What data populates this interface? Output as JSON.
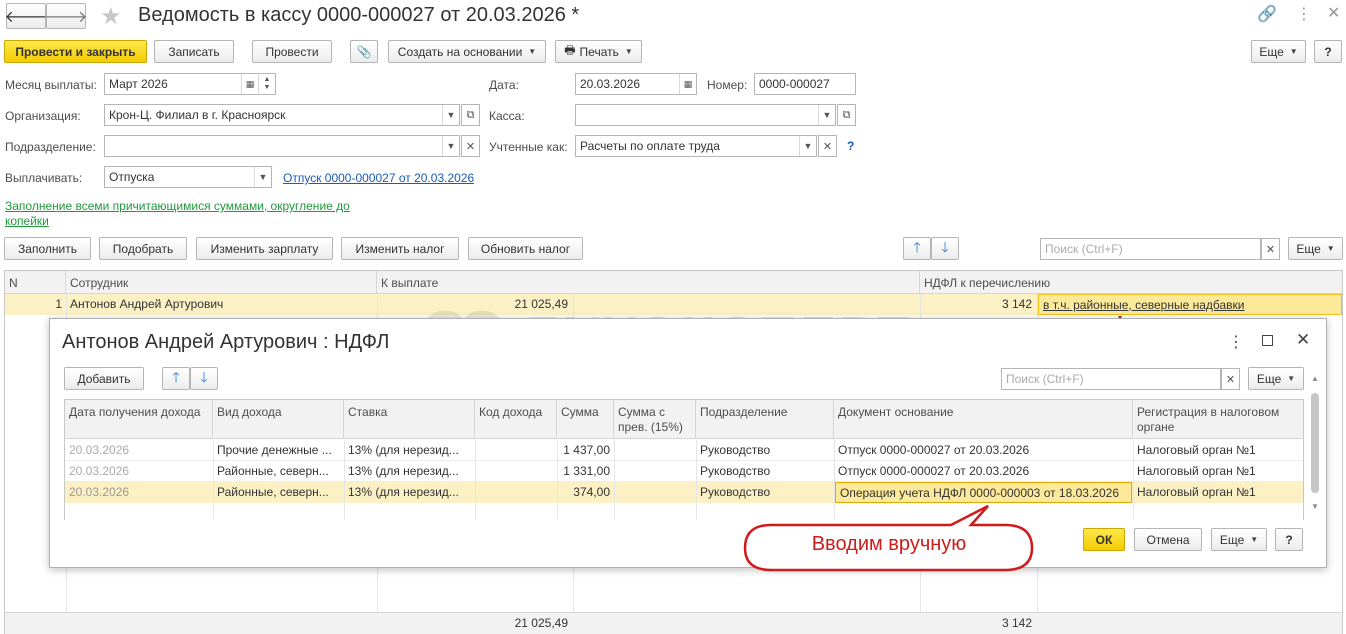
{
  "window": {
    "title": "Ведомость в кассу 0000-000027 от 20.03.2026 *"
  },
  "toolbar": {
    "post_close": "Провести и закрыть",
    "save": "Записать",
    "post": "Провести",
    "create_based": "Создать на основании",
    "print": "Печать",
    "more": "Еще",
    "help": "?"
  },
  "form": {
    "month_label": "Месяц выплаты:",
    "month_value": "Март 2026",
    "date_label": "Дата:",
    "date_value": "20.03.2026",
    "number_label": "Номер:",
    "number_value": "0000-000027",
    "org_label": "Организация:",
    "org_value": "Крон-Ц. Филиал в г. Красноярск",
    "cash_label": "Касса:",
    "cash_value": "",
    "dept_label": "Подразделение:",
    "dept_value": "",
    "accounted_label": "Учтенные как:",
    "accounted_value": "Расчеты по оплате труда",
    "pay_label": "Выплачивать:",
    "pay_value": "Отпуска",
    "pay_link": "Отпуск 0000-000027 от 20.03.2026",
    "fill_link": "Заполнение всеми причитающимися суммами, округление до копейки",
    "help_q": "?"
  },
  "table_toolbar": {
    "fill": "Заполнить",
    "pick": "Подобрать",
    "change_salary": "Изменить зарплату",
    "change_tax": "Изменить налог",
    "update_tax": "Обновить налог",
    "search_placeholder": "Поиск (Ctrl+F)",
    "more": "Еще"
  },
  "main_table": {
    "columns": [
      "N",
      "Сотрудник",
      "К выплате",
      "НДФЛ к перечислению"
    ],
    "rows": [
      {
        "n": "1",
        "employee": "Антонов Андрей Артурович",
        "pay": "21 025,49",
        "ndfl": "3 142",
        "note": "в т.ч. районные, северные надбавки"
      }
    ],
    "footer": {
      "pay": "21 025,49",
      "ndfl": "3 142"
    }
  },
  "watermark": "БУХЭКСПЕРТ",
  "dialog": {
    "title": "Антонов Андрей Артурович : НДФЛ",
    "add": "Добавить",
    "search_placeholder": "Поиск (Ctrl+F)",
    "more": "Еще",
    "columns": [
      "Дата получения дохода",
      "Вид дохода",
      "Ставка",
      "Код дохода",
      "Сумма",
      "Сумма с прев. (15%)",
      "Подразделение",
      "Документ основание",
      "Регистрация в налоговом органе"
    ],
    "rows": [
      {
        "date": "20.03.2026",
        "kind": "Прочие денежные ...",
        "rate": "13% (для нерезид...",
        "code": "",
        "sum": "1 437,00",
        "sum15": "",
        "dept": "Руководство",
        "doc": "Отпуск 0000-000027 от 20.03.2026",
        "reg": "Налоговый орган №1"
      },
      {
        "date": "20.03.2026",
        "kind": "Районные, северн...",
        "rate": "13% (для нерезид...",
        "code": "",
        "sum": "1 331,00",
        "sum15": "",
        "dept": "Руководство",
        "doc": "Отпуск 0000-000027 от 20.03.2026",
        "reg": "Налоговый орган №1"
      },
      {
        "date": "20.03.2026",
        "kind": "Районные, северн...",
        "rate": "13% (для нерезид...",
        "code": "",
        "sum": "374,00",
        "sum15": "",
        "dept": "Руководство",
        "doc": "Операция учета НДФЛ 0000-000003 от 18.03.2026",
        "reg": "Налоговый орган №1"
      }
    ],
    "ok": "ОК",
    "cancel": "Отмена",
    "help": "?"
  },
  "callout": {
    "text": "Вводим вручную"
  },
  "colors": {
    "accent_yellow": "#f5cc00",
    "selected_row": "#fbf1c4",
    "link_blue": "#1a5bb5",
    "callout_red": "#d01b1b"
  }
}
